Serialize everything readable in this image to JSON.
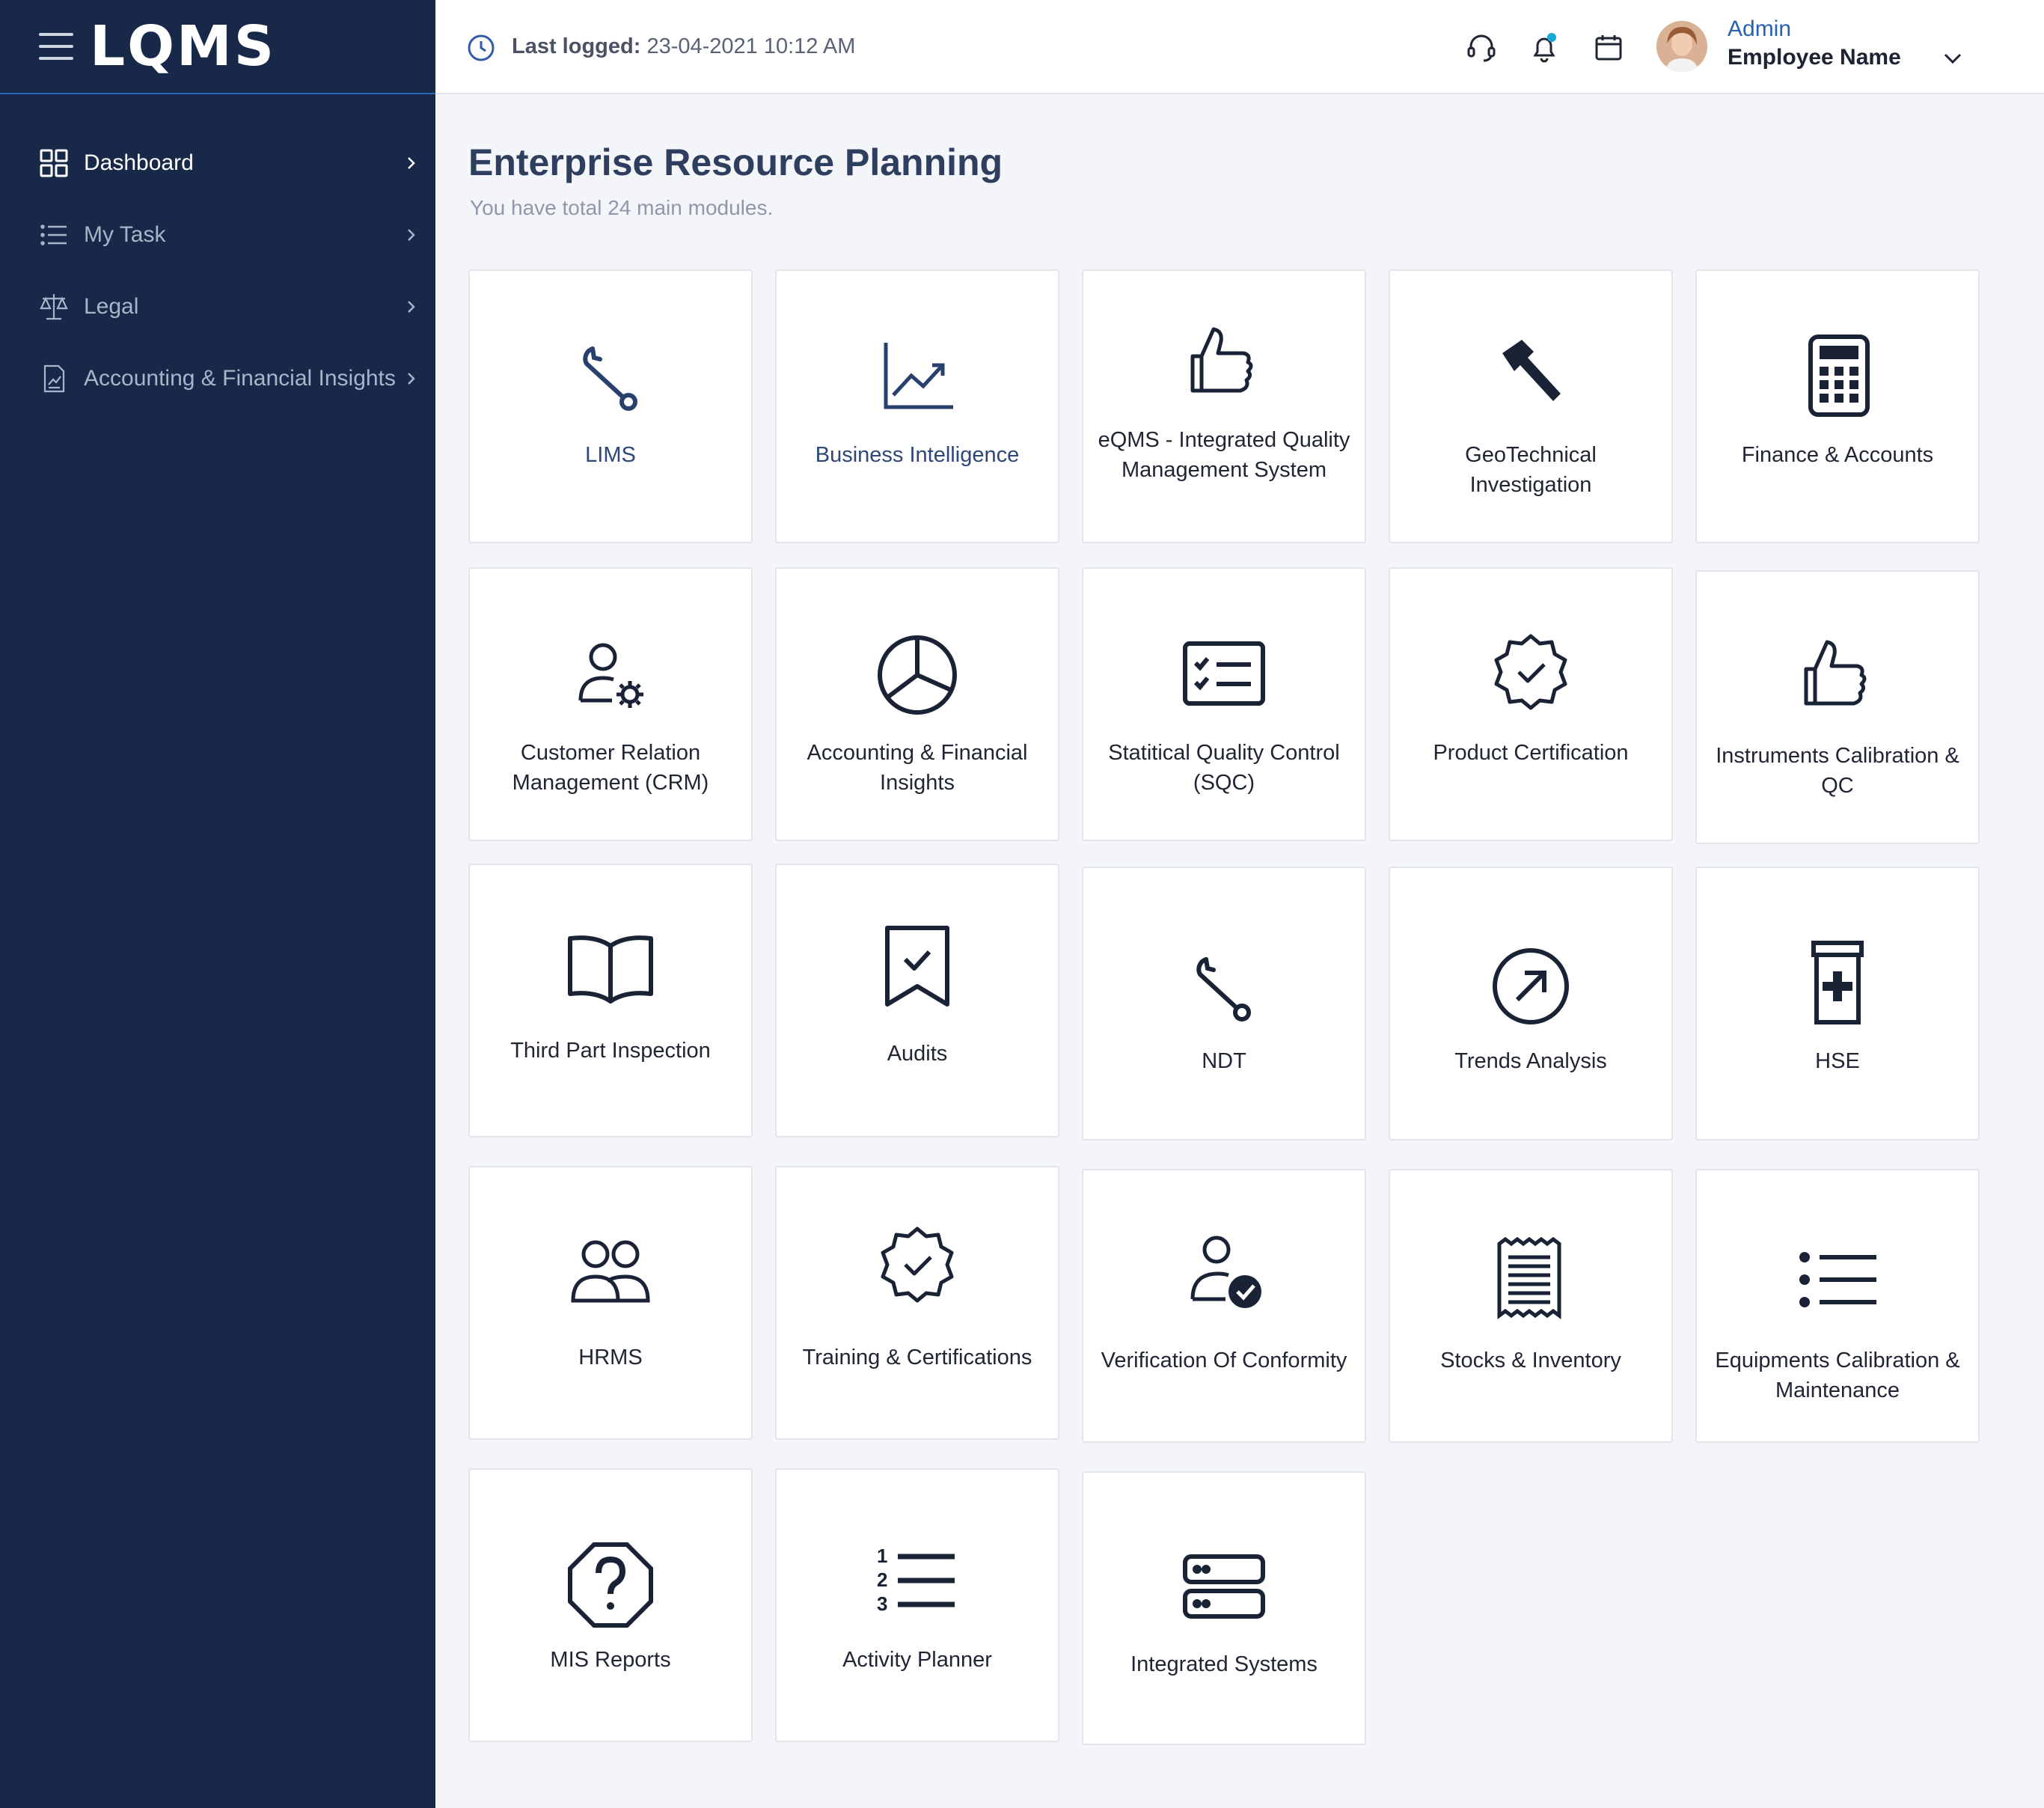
{
  "sidebar": {
    "logo": "LQMS",
    "items": [
      {
        "label": "Dashboard",
        "icon": "grid-icon",
        "active": true
      },
      {
        "label": "My Task",
        "icon": "list-icon",
        "active": false
      },
      {
        "label": "Legal",
        "icon": "scale-icon",
        "active": false
      },
      {
        "label": "Accounting & Financial Insights",
        "icon": "report-icon",
        "active": false
      }
    ]
  },
  "header": {
    "last_logged_label": "Last logged:",
    "last_logged_value": "23-04-2021 10:12 AM",
    "user_role": "Admin",
    "user_name": "Employee Name",
    "notification_dot_color": "#19a8d6"
  },
  "main": {
    "title": "Enterprise Resource Planning",
    "subtitle": "You have total 24 main modules.",
    "modules": [
      {
        "label": "LIMS",
        "icon": "wrench-icon"
      },
      {
        "label": "Business Intelligence",
        "icon": "line-chart-icon"
      },
      {
        "label": "eQMS - Integrated Quality Management System",
        "icon": "thumbs-up-icon"
      },
      {
        "label": "GeoTechnical Investigation",
        "icon": "hammer-icon"
      },
      {
        "label": "Finance & Accounts",
        "icon": "calculator-icon"
      },
      {
        "label": "Customer Relation Management (CRM)",
        "icon": "user-gear-icon"
      },
      {
        "label": "Accounting & Financial Insights",
        "icon": "pie-chart-icon"
      },
      {
        "label": "Statitical Quality Control (SQC)",
        "icon": "checklist-card-icon"
      },
      {
        "label": "Product Certification",
        "icon": "badge-check-icon"
      },
      {
        "label": "Instruments Calibration & QC",
        "icon": "thumbs-up-icon"
      },
      {
        "label": "Third Part Inspection",
        "icon": "open-book-icon"
      },
      {
        "label": "Audits",
        "icon": "bookmark-check-icon"
      },
      {
        "label": "NDT",
        "icon": "wrench-icon"
      },
      {
        "label": "Trends Analysis",
        "icon": "arrow-circle-icon"
      },
      {
        "label": "HSE",
        "icon": "medical-bottle-icon"
      },
      {
        "label": "HRMS",
        "icon": "users-icon"
      },
      {
        "label": "Training & Certifications",
        "icon": "badge-check-icon"
      },
      {
        "label": "Verification Of Conformity",
        "icon": "user-check-icon"
      },
      {
        "label": "Stocks & Inventory",
        "icon": "receipt-icon"
      },
      {
        "label": "Equipments Calibration & Maintenance",
        "icon": "bullet-list-icon"
      },
      {
        "label": "MIS Reports",
        "icon": "question-octagon-icon"
      },
      {
        "label": "Activity Planner",
        "icon": "numbered-list-icon"
      },
      {
        "label": "Integrated Systems",
        "icon": "server-icon"
      }
    ]
  }
}
